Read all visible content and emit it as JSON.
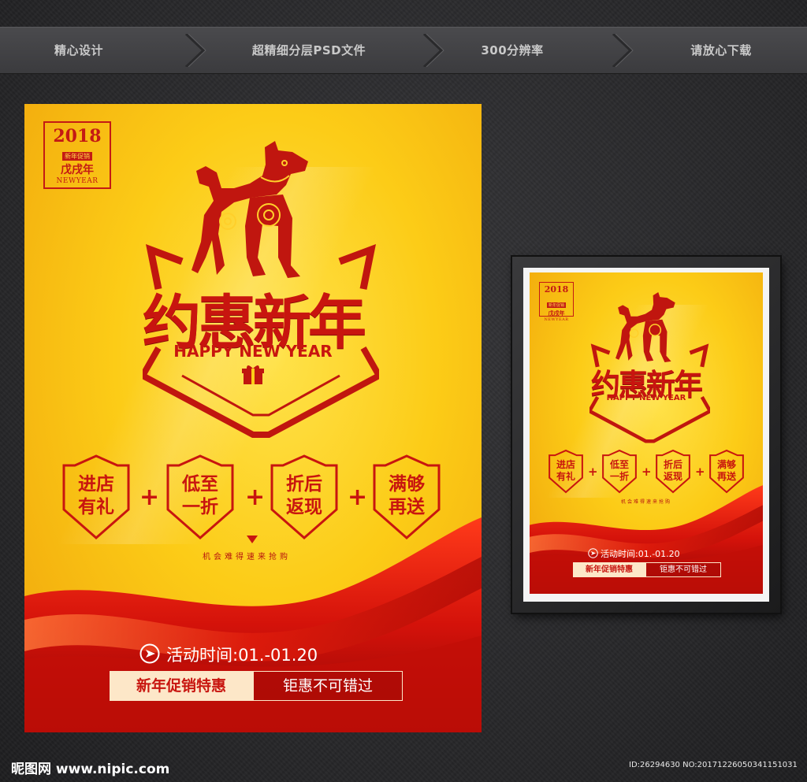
{
  "topbar": {
    "items": [
      "精心设计",
      "超精细分层PSD文件",
      "300分辨率",
      "请放心下载"
    ]
  },
  "poster": {
    "stamp": {
      "year": "2018",
      "label": "新年促销",
      "zodiac": "戊戌年",
      "en": "NEWYEAR"
    },
    "headline": "约惠新年",
    "subtitle": "HAPPY NEW YEAR",
    "badges": [
      {
        "line1": "进店",
        "line2": "有礼"
      },
      {
        "line1": "低至",
        "line2": "一折"
      },
      {
        "line1": "折后",
        "line2": "返现"
      },
      {
        "line1": "满够",
        "line2": "再送"
      }
    ],
    "plus": "+",
    "tagline": "机会难得速来抢购",
    "time": "活动时间:01.-01.20",
    "button_left": "新年促销特惠",
    "button_right": "钜惠不可错过"
  },
  "footer": {
    "site": "昵图网 www.nipic.com",
    "id": "ID:26294630 NO:20171226050341151031"
  },
  "colors": {
    "red": "#c8150f",
    "yellow": "#fccc17",
    "bg": "#2b2b2d"
  }
}
